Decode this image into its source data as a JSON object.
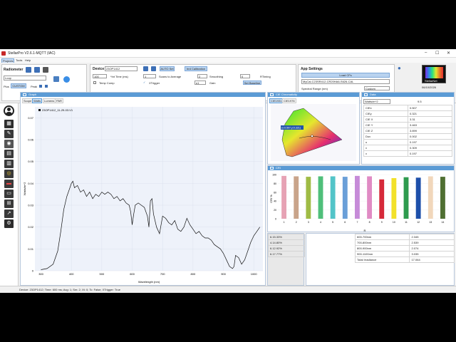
{
  "window": {
    "title": "StellarPro V2.6.1-MQTT (IAC)"
  },
  "menu": {
    "items": [
      "Projects",
      "Tools",
      "Help"
    ]
  },
  "radiometer": {
    "label": "Radiometer",
    "mode": "Loop",
    "plus_label": "Plus",
    "custom": "CUSTOM",
    "peak_label": "Peak"
  },
  "device": {
    "label": "Device",
    "value": "23OP1412",
    "auto_set": "AUTO Set",
    "cal_label": "Irrd Calibration",
    "count": "100",
    "int_time_label": "*Int Time (ms)",
    "scans_value": "1",
    "scans_label": "Scans to Average",
    "smoothing_value": "2",
    "smoothing_label": "Smoothing",
    "rt_value": "0",
    "rt_label": "RTiming",
    "temp_comp": "Temp Comp",
    "xtrigger": "XTrigger",
    "gain_value": "p1",
    "gain_label": "Gain",
    "baseline": "Set Baseline"
  },
  "app_settings": {
    "label": "App Settings",
    "load_cfg": "Load CFs",
    "cfg_value": "MyCal-C23SR412-CR20HA6-S626-CAL",
    "spectral_label": "Spectral Range (nm)",
    "spectral_value": "Custom"
  },
  "logo": {
    "date": "06/10/2026",
    "brand": "StellarNet"
  },
  "sidebar": {
    "icons": [
      "gear-icon"
    ]
  },
  "graph": {
    "title": "Graph",
    "tabs": [
      "Scope",
      "Watts",
      "Lumens",
      "PAR"
    ],
    "legend": "23OP1412_11-29-03.V1"
  },
  "chart_data": {
    "type": "line",
    "xlabel": "Wavelength (nm)",
    "ylabel": "Watts/m^2",
    "xlim": [
      280,
      1030
    ],
    "ylim": [
      0,
      0.075
    ],
    "xticks": [
      300,
      400,
      500,
      600,
      700,
      800,
      900,
      1000
    ],
    "yticks": [
      0,
      0.01,
      0.02,
      0.03,
      0.04,
      0.05,
      0.06,
      0.07
    ],
    "ytick_labels": [
      "0",
      "0.01",
      "0.02",
      "0.03",
      "0.04",
      "0.05",
      "0.06",
      "0.07"
    ],
    "line_color": "#111111",
    "series": [
      {
        "x": [
          300,
          320,
          340,
          355,
          365,
          375,
          385,
          395,
          400,
          405,
          410,
          420,
          430,
          440,
          450,
          460,
          470,
          480,
          490,
          500,
          510,
          520,
          530,
          540,
          550,
          560,
          570,
          580,
          590,
          595,
          600,
          605,
          610,
          620,
          630,
          640,
          650,
          655,
          660,
          665,
          670,
          680,
          690,
          700,
          710,
          720,
          730,
          740,
          750,
          760,
          770,
          780,
          790,
          800,
          810,
          820,
          830,
          840,
          850,
          860,
          870,
          880,
          890,
          900,
          910,
          920,
          930,
          935,
          940,
          950,
          960,
          970,
          980,
          990,
          1000,
          1010,
          1020
        ],
        "y": [
          0.0005,
          0.001,
          0.003,
          0.009,
          0.018,
          0.028,
          0.034,
          0.038,
          0.04,
          0.041,
          0.038,
          0.039,
          0.036,
          0.037,
          0.034,
          0.036,
          0.033,
          0.035,
          0.034,
          0.036,
          0.035,
          0.036,
          0.035,
          0.033,
          0.034,
          0.032,
          0.033,
          0.031,
          0.03,
          0.027,
          0.021,
          0.026,
          0.03,
          0.031,
          0.03,
          0.029,
          0.025,
          0.02,
          0.032,
          0.033,
          0.026,
          0.02,
          0.017,
          0.025,
          0.024,
          0.022,
          0.021,
          0.023,
          0.019,
          0.018,
          0.02,
          0.024,
          0.021,
          0.019,
          0.017,
          0.018,
          0.016,
          0.015,
          0.015,
          0.014,
          0.012,
          0.011,
          0.01,
          0.008,
          0.005,
          0.002,
          0.001,
          0.002,
          0.007,
          0.006,
          0.003,
          0.005,
          0.009,
          0.013,
          0.016,
          0.018,
          0.02
        ]
      }
    ]
  },
  "cie": {
    "title": "CIE Chromaticity",
    "tabs": [
      "CIE1931",
      "CIE1976"
    ],
    "point_label": "(x:0.507,y:0.321)",
    "point_x": 0.507,
    "point_y": 0.321
  },
  "data_panel": {
    "title": "Data",
    "unit": "Watts/m^2",
    "unit_value": "9.5",
    "rows": [
      {
        "label": "CIEx",
        "value": "0.507"
      },
      {
        "label": "CIEy",
        "value": "0.321"
      },
      {
        "label": "CIE X",
        "value": "3.31"
      },
      {
        "label": "CIE Y",
        "value": "3.463"
      },
      {
        "label": "CIE Z",
        "value": "3.899"
      },
      {
        "label": "Duv",
        "value": "0.002"
      },
      {
        "label": "u",
        "value": "0.197"
      },
      {
        "label": "v",
        "value": "0.309"
      },
      {
        "label": "v",
        "value": "0.197"
      }
    ]
  },
  "cri": {
    "title": "CRI",
    "ylabel": "CRI %",
    "xlabel": "R",
    "bars": [
      {
        "label": "1",
        "value": 97,
        "color": "#e6a2b4"
      },
      {
        "label": "2",
        "value": 96,
        "color": "#c9a48a"
      },
      {
        "label": "3",
        "value": 95,
        "color": "#9fbb45"
      },
      {
        "label": "4",
        "value": 96,
        "color": "#4fbf7a"
      },
      {
        "label": "5",
        "value": 96,
        "color": "#52c4c8"
      },
      {
        "label": "6",
        "value": 95,
        "color": "#6a9fd8"
      },
      {
        "label": "7",
        "value": 97,
        "color": "#c68bd8"
      },
      {
        "label": "8",
        "value": 96,
        "color": "#e08bc4"
      },
      {
        "label": "9",
        "value": 89,
        "color": "#d62a3a"
      },
      {
        "label": "10",
        "value": 92,
        "color": "#f2e12a"
      },
      {
        "label": "11",
        "value": 94,
        "color": "#2e9b4e"
      },
      {
        "label": "12",
        "value": 93,
        "color": "#1d4faa"
      },
      {
        "label": "13",
        "value": 96,
        "color": "#f1d7bb"
      },
      {
        "label": "14",
        "value": 95,
        "color": "#4f6f32"
      }
    ]
  },
  "bottom_left": {
    "rows": [
      "6.15.33%",
      "4.14.80%",
      "6.12.92%",
      "6.17.77%"
    ]
  },
  "irradiance": {
    "rows": [
      {
        "range": "600-700nm",
        "value": "2.345"
      },
      {
        "range": "700-800nm",
        "value": "2.539"
      },
      {
        "range": "800-900nm",
        "value": "2.074"
      },
      {
        "range": "900-1100nm",
        "value": "3.035"
      },
      {
        "range": "Total Irradiance",
        "value": "17.064"
      }
    ]
  },
  "status": {
    "text": "Device: 23OP1412; Time: 600 ms; Avg: 1; Sm: 2; Xt: 0; Tc: False; XTrigger: True"
  }
}
